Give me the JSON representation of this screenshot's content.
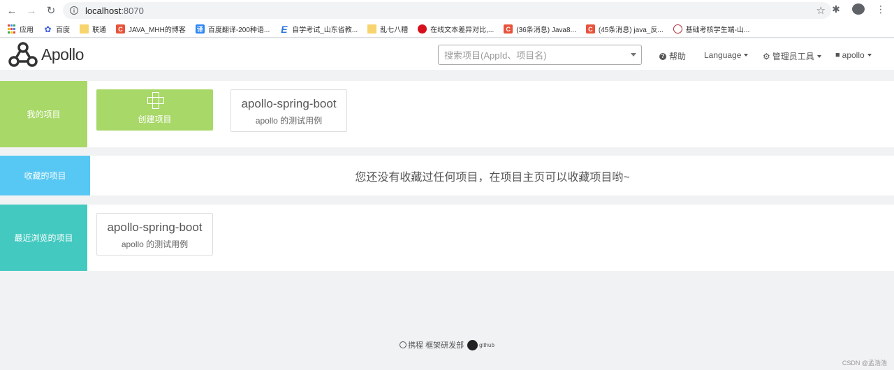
{
  "browser": {
    "url_host": "localhost",
    "url_port": ":8070"
  },
  "bookmarks": [
    {
      "label": "应用",
      "icon": "apps-grid-icon"
    },
    {
      "label": "百度",
      "icon": "baidu-paw-icon"
    },
    {
      "label": "联通",
      "icon": "folder-icon"
    },
    {
      "label": "JAVA_MHH的博客",
      "icon": "csdn-icon"
    },
    {
      "label": "百度翻译-200种语...",
      "icon": "baidu-translate-icon"
    },
    {
      "label": "自学考试_山东省教...",
      "icon": "e-icon"
    },
    {
      "label": "乱七八糟",
      "icon": "folder-icon"
    },
    {
      "label": "在线文本差异对比,...",
      "icon": "red-circle-icon"
    },
    {
      "label": "(36条消息) Java8...",
      "icon": "csdn-icon"
    },
    {
      "label": "(45条消息) java_反...",
      "icon": "csdn-icon"
    },
    {
      "label": "基础考核学生端-山...",
      "icon": "seal-icon"
    }
  ],
  "header": {
    "logo_text": "Apollo",
    "search_placeholder": "搜索项目(AppId、项目名)",
    "help": "帮助",
    "language": "Language",
    "admin_tools": "管理员工具",
    "user": "apollo"
  },
  "sections": {
    "my_projects": {
      "label": "我的项目",
      "color": "#a8d868",
      "create_label": "创建项目",
      "projects": [
        {
          "name": "apollo-spring-boot",
          "desc": "apollo 的测试用例"
        }
      ]
    },
    "favorites": {
      "label": "收藏的项目",
      "color": "#57c7f3",
      "empty_message": "您还没有收藏过任何项目，在项目主页可以收藏项目哟~"
    },
    "recent": {
      "label": "最近浏览的项目",
      "color": "#43c9c0",
      "projects": [
        {
          "name": "apollo-spring-boot",
          "desc": "apollo 的测试用例"
        }
      ]
    }
  },
  "footer": {
    "org_text": "携程 框架研发部",
    "github_text": "github"
  },
  "watermark": "CSDN @孟浩浩"
}
